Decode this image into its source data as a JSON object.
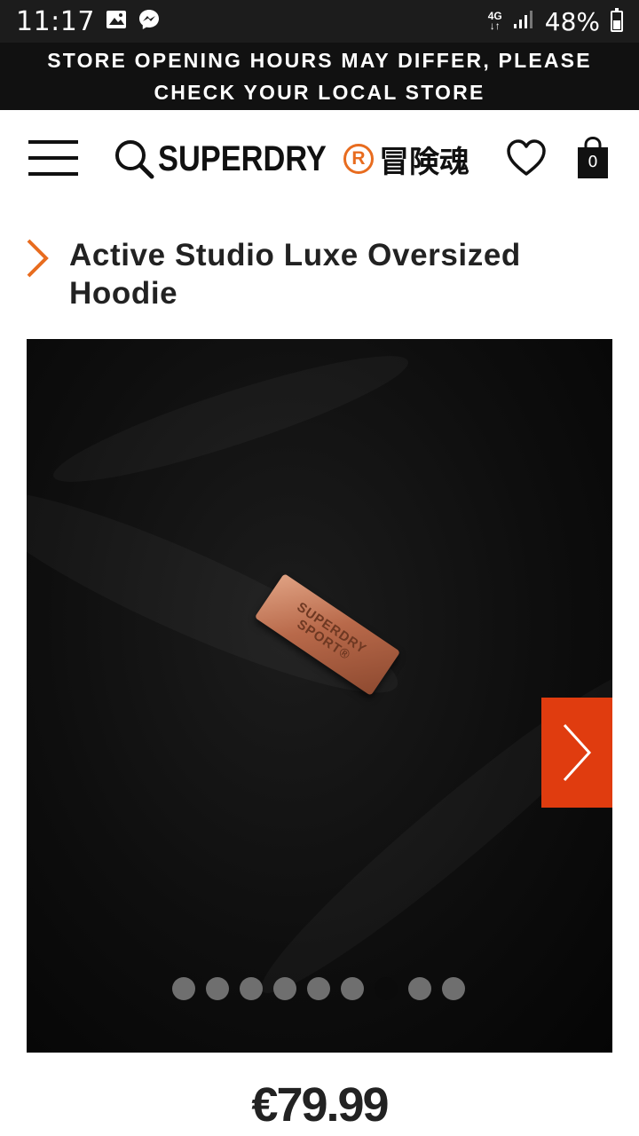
{
  "status_bar": {
    "time": "11:17",
    "network": "4G",
    "battery": "48%",
    "battery_level": 0.48,
    "icons": [
      "image-icon",
      "messenger-icon",
      "signal-icon",
      "battery-icon"
    ]
  },
  "announcement": {
    "text": "STORE OPENING HOURS MAY DIFFER, PLEASE CHECK YOUR LOCAL STORE"
  },
  "header": {
    "brand": "SUPERDRY",
    "brand_mark": "R",
    "brand_jp": "冒険魂",
    "bag_count": "0",
    "icons": [
      "menu-icon",
      "search-icon",
      "heart-icon",
      "bag-icon"
    ],
    "accent_color": "#e86c1f"
  },
  "product": {
    "title": "Active Studio Luxe Oversized Hoodie",
    "price": "€79.99",
    "badge_line1": "SUPERDRY",
    "badge_line2": "SPORT®"
  },
  "gallery": {
    "slide_count": 9,
    "active_index": 6,
    "next_button_color": "#e03c0f"
  }
}
